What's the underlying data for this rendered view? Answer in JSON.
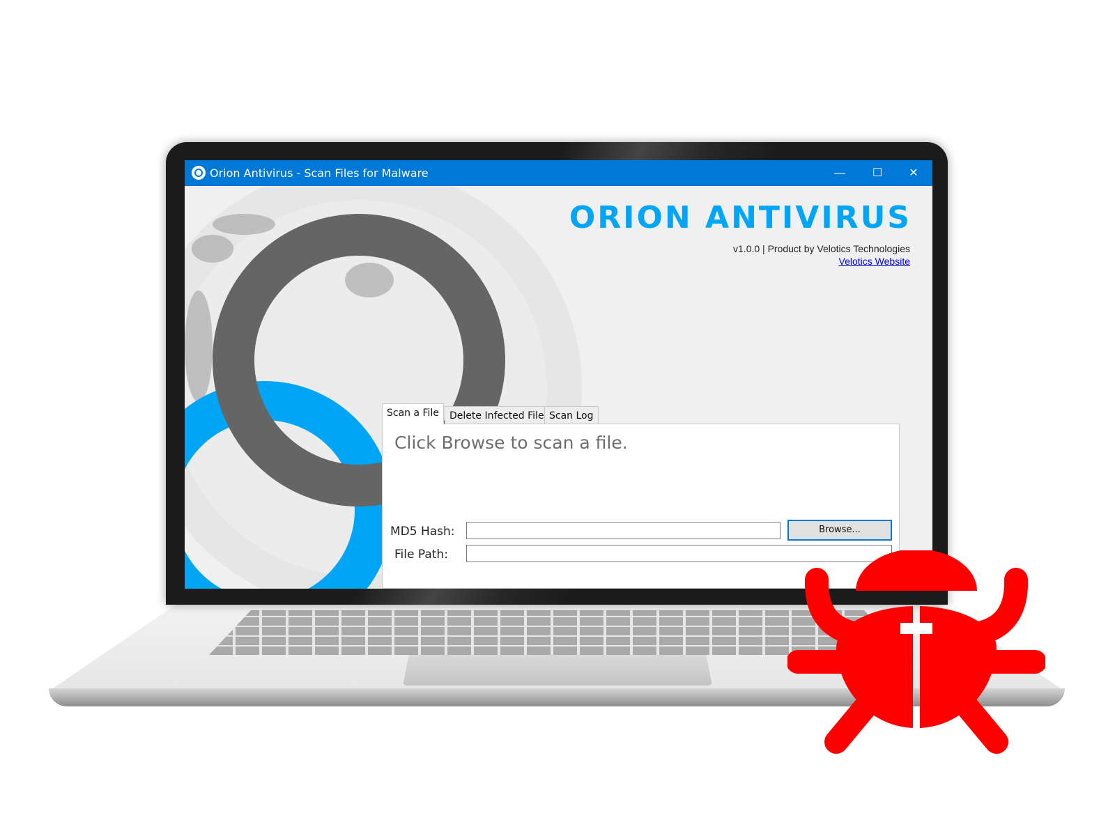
{
  "window": {
    "title": "Orion Antivirus - Scan Files for Malware",
    "minimize_glyph": "—",
    "maximize_glyph": "☐",
    "close_glyph": "✕"
  },
  "brand": {
    "name": "ORION ANTIVIRUS",
    "subtitle": "v1.0.0 | Product by Velotics Technologies",
    "link_text": "Velotics Website",
    "accent_color": "#00a6f5"
  },
  "tabs": [
    {
      "label": "Scan a File",
      "active": true
    },
    {
      "label": "Delete Infected File",
      "active": false
    },
    {
      "label": "Scan Log",
      "active": false
    }
  ],
  "scan_panel": {
    "message": "Click Browse to scan a file.",
    "md5_label": "MD5 Hash:",
    "md5_value": "",
    "file_path_label": "File Path:",
    "file_path_value": "",
    "browse_label": "Browse..."
  },
  "overlay": {
    "icon": "bug-icon",
    "color": "#ff0000"
  }
}
